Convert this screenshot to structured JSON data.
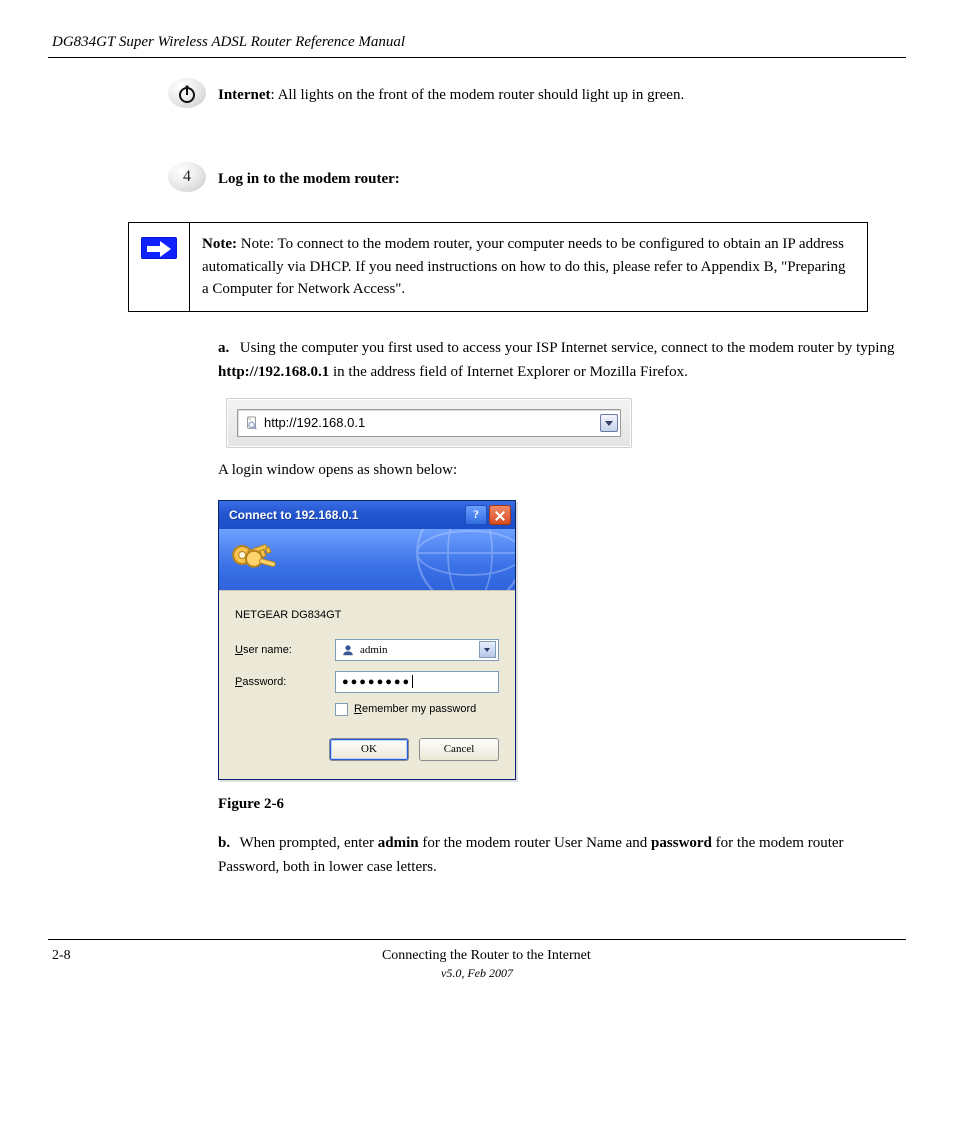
{
  "header": {
    "left": "DG834GT Super Wireless ADSL Router Reference Manual",
    "right": ""
  },
  "step_internet": {
    "text": "All lights on the front of the modem router should light up in green."
  },
  "step_login_title": "Log in to the modem router:",
  "note": {
    "text": "Note: To connect to the modem router, your computer needs to be configured to obtain an IP address automatically via DHCP. If you need instructions on how to do this, please refer to Appendix B, \"Preparing a Computer for Network Access\"."
  },
  "substeps": {
    "a_prefix": "a.",
    "a_text1": "Using the computer you first used to access your ISP Internet service, connect to the modem router by typing ",
    "a_bold": "http://192.168.0.1",
    "a_text2": " in the address field of Internet Explorer or Mozilla Firefox.",
    "url_display": "http://192.168.0.1",
    "after_url": "A login window opens as shown below:",
    "b_prefix": "b.",
    "b_text1": "When prompted, enter ",
    "b_bold1": "admin",
    "b_text2": " for the modem router User Name and ",
    "b_bold2": "password",
    "b_text3": " for the modem router Password, both in lower case letters."
  },
  "dialog": {
    "title": "Connect to 192.168.0.1",
    "realm": "NETGEAR DG834GT",
    "user_label_pre": "U",
    "user_label_rest": "ser name:",
    "user_value": "admin",
    "pw_label_pre": "P",
    "pw_label_rest": "assword:",
    "pw_masked": "●●●●●●●●",
    "remember_pre": "R",
    "remember_rest": "emember my password",
    "ok": "OK",
    "cancel": "Cancel"
  },
  "figure_caption": "Figure 2-6",
  "footer": {
    "left": "2-8",
    "center": "Connecting the Router to the Internet",
    "right": "v5.0, Feb 2007"
  }
}
